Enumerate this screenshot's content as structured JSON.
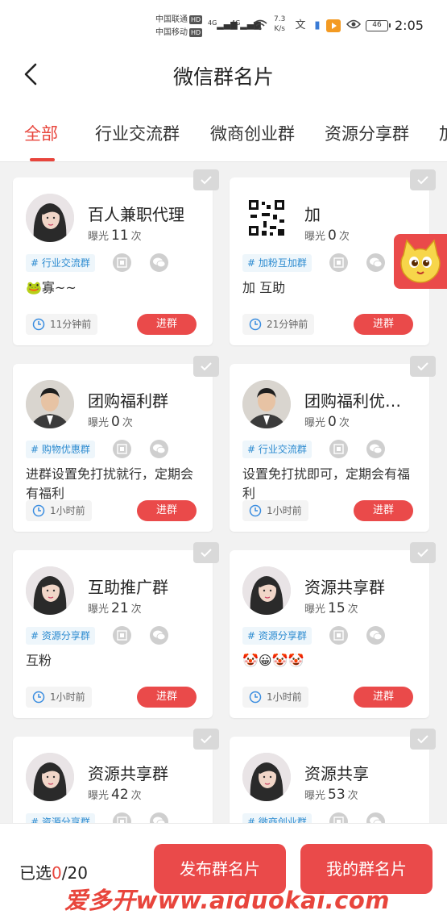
{
  "status_bar": {
    "carrier1": "中国联通",
    "carrier2": "中国移动",
    "hd": "HD",
    "net1": "4G",
    "net2": "4G",
    "speed_value": "7.3",
    "speed_unit": "K/s",
    "battery": "46",
    "time": "2:05"
  },
  "header": {
    "title": "微信群名片"
  },
  "tabs": [
    "全部",
    "行业交流群",
    "微商创业群",
    "资源分享群",
    "加"
  ],
  "cards": [
    {
      "name": "百人兼职代理",
      "exposure_label": "曝光",
      "exposure": "11",
      "exposure_unit": "次",
      "tag": "# 行业交流群",
      "desc": "🐸寡~~",
      "time": "11分钟前",
      "join": "进群",
      "hair": "#2a2a2a"
    },
    {
      "name": "加",
      "exposure_label": "曝光",
      "exposure": "0",
      "exposure_unit": "次",
      "tag": "# 加粉互加群",
      "desc": "加 互助",
      "time": "21分钟前",
      "join": "进群",
      "hair": "qr"
    },
    {
      "name": "团购福利群",
      "exposure_label": "曝光",
      "exposure": "0",
      "exposure_unit": "次",
      "tag": "# 购物优惠群",
      "desc": "进群设置免打扰就行，定期会有福利",
      "time": "1小时前",
      "join": "进群",
      "hair": "man"
    },
    {
      "name": "团购福利优…",
      "exposure_label": "曝光",
      "exposure": "0",
      "exposure_unit": "次",
      "tag": "# 行业交流群",
      "desc": "设置免打扰即可，定期会有福利",
      "time": "1小时前",
      "join": "进群",
      "hair": "man"
    },
    {
      "name": "互助推广群",
      "exposure_label": "曝光",
      "exposure": "21",
      "exposure_unit": "次",
      "tag": "# 资源分享群",
      "desc": "互粉",
      "time": "1小时前",
      "join": "进群",
      "hair": "#2a2a2a"
    },
    {
      "name": "资源共享群",
      "exposure_label": "曝光",
      "exposure": "15",
      "exposure_unit": "次",
      "tag": "# 资源分享群",
      "desc": "🤡😀🤡🤡",
      "time": "1小时前",
      "join": "进群",
      "hair": "#2a2a2a"
    },
    {
      "name": "资源共享群",
      "exposure_label": "曝光",
      "exposure": "42",
      "exposure_unit": "次",
      "tag": "# 资源分享群",
      "desc": "",
      "time": "",
      "join": "",
      "hair": "#2a2a2a"
    },
    {
      "name": "资源共享",
      "exposure_label": "曝光",
      "exposure": "53",
      "exposure_unit": "次",
      "tag": "# 微商创业群",
      "desc": "",
      "time": "",
      "join": "",
      "hair": "#2a2a2a"
    }
  ],
  "bottom": {
    "selected_label": "已选",
    "selected_count": "0",
    "selected_total": "/20",
    "publish_button": "发布群名片",
    "my_button": "我的群名片"
  },
  "watermark": "爱多开www.aiduokai.com",
  "colors": {
    "accent": "#e8453c",
    "tag_text": "#2c8bd0",
    "tag_bg": "#eef6fb"
  }
}
